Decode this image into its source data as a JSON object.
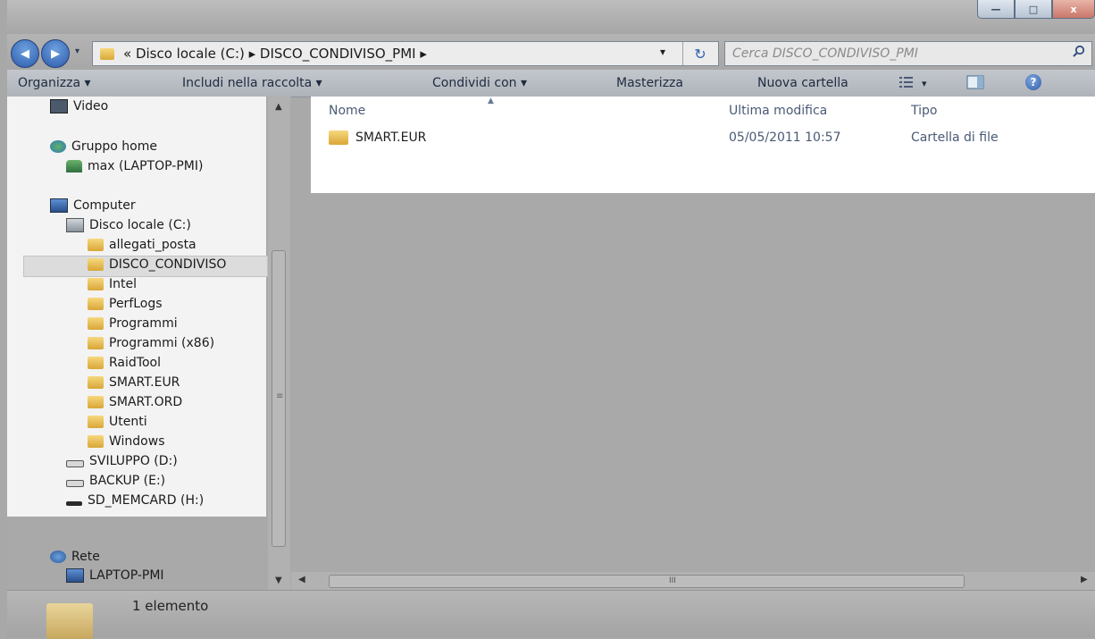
{
  "window": {
    "controls": {
      "minimize": "—",
      "maximize": "□",
      "close": "x"
    }
  },
  "nav": {
    "back_glyph": "◀",
    "forward_glyph": "▶",
    "breadcrumb": "« Disco locale (C:) ▸ DISCO_CONDIVISO_PMI ▸",
    "dropdown_glyph": "▾",
    "refresh_glyph": "↻",
    "search_placeholder": "Cerca DISCO_CONDIVISO_PMI",
    "search_icon": "magnifier-icon"
  },
  "toolbar": {
    "organize": "Organizza ▾",
    "include": "Includi nella raccolta ▾",
    "share": "Condividi con ▾",
    "burn": "Masterizza",
    "new_folder": "Nuova cartella",
    "views_caret": "▾",
    "help_glyph": "?"
  },
  "sidebar": {
    "video": "Video",
    "homegroup": "Gruppo home",
    "homegroup_user": "max (LAPTOP-PMI)",
    "computer": "Computer",
    "drive_c": "Disco locale (C:)",
    "folders": [
      "allegati_posta",
      "DISCO_CONDIVISO",
      "Intel",
      "PerfLogs",
      "Programmi",
      "Programmi (x86)",
      "RaidTool",
      "SMART.EUR",
      "SMART.ORD",
      "Utenti",
      "Windows"
    ],
    "drives": [
      "SVILUPPO (D:)",
      "BACKUP (E:)",
      "SD_MEMCARD (H:)"
    ],
    "network": "Rete",
    "network_pc": "LAPTOP-PMI"
  },
  "content": {
    "columns": {
      "name": "Nome",
      "modified": "Ultima modifica",
      "type": "Tipo"
    },
    "rows": [
      {
        "name": "SMART.EUR",
        "modified": "05/05/2011 10:57",
        "type": "Cartella di file"
      }
    ]
  },
  "status": {
    "count": "1 elemento"
  },
  "colors": {
    "folder": "#e8b84a",
    "selection": "#dcdcdc",
    "accent": "#2a5aa8"
  }
}
